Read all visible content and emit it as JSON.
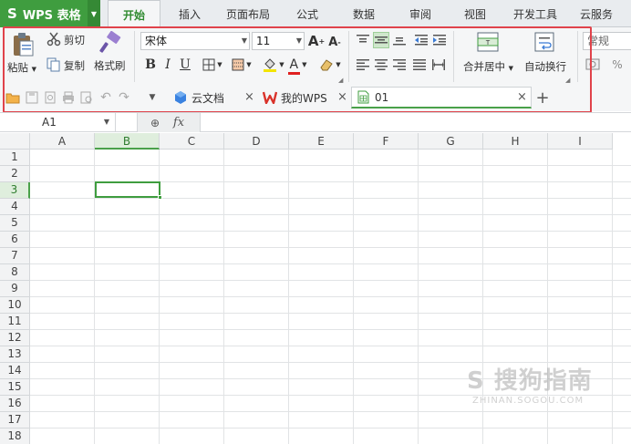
{
  "app": {
    "logo": "S",
    "name": "WPS 表格"
  },
  "ribbon_tabs": [
    "开始",
    "插入",
    "页面布局",
    "公式",
    "数据",
    "审阅",
    "视图",
    "开发工具",
    "云服务"
  ],
  "clipboard": {
    "paste": "粘贴",
    "cut": "剪切",
    "copy": "复制",
    "format_painter": "格式刷"
  },
  "font": {
    "name": "宋体",
    "size": "11",
    "grow": "A",
    "shrink": "A",
    "bold": "B",
    "italic": "I",
    "underline": "U",
    "font_color_letter": "A"
  },
  "alignment": {
    "merge_center": "合并居中",
    "wrap_text": "自动换行"
  },
  "number_format": {
    "value": "常规",
    "percent": "%"
  },
  "doc_tabs": [
    {
      "label": "云文档"
    },
    {
      "label": "我的WPS"
    },
    {
      "label": "01"
    }
  ],
  "new_tab": "+",
  "formula_bar": {
    "cell_ref": "A1",
    "fx": "fx"
  },
  "columns": [
    "A",
    "B",
    "C",
    "D",
    "E",
    "F",
    "G",
    "H",
    "I"
  ],
  "rows": [
    "1",
    "2",
    "3",
    "4",
    "5",
    "6",
    "7",
    "8",
    "9",
    "10",
    "11",
    "12",
    "13",
    "14",
    "15",
    "16",
    "17",
    "18"
  ],
  "selected": {
    "column": "B",
    "row": "3"
  },
  "watermark": {
    "main": "S 搜狗指南",
    "sub": "ZHINAN.SOGOU.COM"
  },
  "colors": {
    "accent_green": "#3f9d3f",
    "highlight_red": "#e0434b",
    "wps_red": "#d9322a"
  }
}
